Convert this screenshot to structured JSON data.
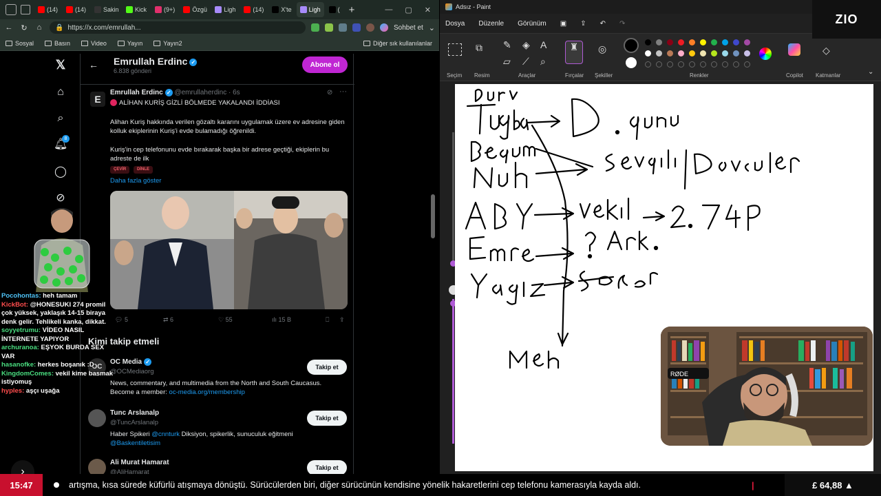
{
  "browser": {
    "tabs": [
      {
        "label": "(14)",
        "color": "#ff0000"
      },
      {
        "label": "(14)",
        "color": "#ff0000"
      },
      {
        "label": "Sakin",
        "color": "#333333"
      },
      {
        "label": "Kick",
        "color": "#53fc18"
      },
      {
        "label": "(9+)",
        "color": "#e1306c"
      },
      {
        "label": "Özgü",
        "color": "#ff0000"
      },
      {
        "label": "Ligh",
        "color": "#a78bfa"
      },
      {
        "label": "(14)",
        "color": "#ff0000"
      },
      {
        "label": "X'te",
        "color": "#000000"
      },
      {
        "label": "Ligh",
        "color": "#a78bfa"
      },
      {
        "label": "(",
        "color": "#000000"
      }
    ],
    "url": "https://x.com/emrullah...",
    "chat_button": "Sohbet et",
    "bookmarks": [
      "Sosyal",
      "Basın",
      "Video",
      "Yayın",
      "Yayın2"
    ],
    "other_bookmarks": "Diğer sık kullanılanlar"
  },
  "x": {
    "profile_name": "Emrullah Erdinc",
    "profile_posts": "6.838 gönderi",
    "subscribe": "Abone ol",
    "notif_count": "8",
    "post": {
      "author": "Emrullah Erdinc",
      "handle": "@emrullaherdinc · 6s",
      "headline": "ALİHAN KURİŞ GİZLİ BÖLMEDE YAKALANDI İDDİASI",
      "p1": "Alihan Kuriş hakkında verilen gözaltı kararını uygulamak üzere ev adresine giden kolluk ekiplerinin Kuriş'i evde bulamadığı öğrenildi.",
      "p2": "Kuriş'in cep telefonunu evde bırakarak başka bir adrese geçtiği, ekiplerin bu adreste de ilk",
      "pill1": "ÇEVİR",
      "pill2": "DİNLE",
      "show_more": "Daha fazla göster",
      "replies": "5",
      "reposts": "6",
      "likes": "55",
      "views": "15 B"
    },
    "who_to_follow": "Kimi takip etmeli",
    "follow_label": "Takip et",
    "accounts": [
      {
        "name": "OC Media",
        "handle": "@OCMediaorg",
        "bio": "News, commentary, and multimedia from the North and South Caucasus. Become a member: ",
        "link": "oc-media.org/membership"
      },
      {
        "name": "Tunc Arslanalp",
        "handle": "@TuncArslanalp",
        "bio_pre": "Haber Spikeri ",
        "bio_link1": "@cnnturk",
        "bio_mid": " Diksiyon, spikerlik, sunuculuk eğitmeni",
        "bio_link2": "@Baskentiletisim"
      },
      {
        "name": "Ali Murat Hamarat",
        "handle": "@AliHamarat"
      }
    ]
  },
  "chat": [
    {
      "user": "Pocohontas:",
      "msg": "heh tamam",
      "color": "#4fc3f7"
    },
    {
      "user": "KickBot:",
      "msg": "@HONESUKI 274 promil çok yüksek, yaklaşık 14-15 biraya denk gelir. Tehlikeli kanka, dikkat.",
      "color": "#ff4d4d"
    },
    {
      "user": "soyyetrumu:",
      "msg": "VİDEO NASIL İNTERNETE YAPIYOR",
      "color": "#4ade80"
    },
    {
      "user": "archuranoa:",
      "msg": "EŞYOK BURDA SEX VAR",
      "color": "#4ade80"
    },
    {
      "user": "hasanofke:",
      "msg": "herkes boşanık :D",
      "color": "#4ade80"
    },
    {
      "user": "KingdomComes:",
      "msg": "vekil kime basmak istiyomuş",
      "color": "#4ade80"
    },
    {
      "user": "hyples:",
      "msg": "aşçı uşağa",
      "color": "#ff4d4d"
    }
  ],
  "paint": {
    "title": "Adsız - Paint",
    "menu": [
      "Dosya",
      "Düzenle",
      "Görünüm"
    ],
    "sections": [
      "Seçim",
      "Resim",
      "Araçlar",
      "Fırçalar",
      "Şekiller",
      "Renkler",
      "Copilot",
      "Katmanlar"
    ],
    "palette": [
      "#000000",
      "#7f7f7f",
      "#880015",
      "#ed1c24",
      "#ff7f27",
      "#fff200",
      "#22b14c",
      "#00a2e8",
      "#3f48cc",
      "#a349a4",
      "#ffffff",
      "#c3c3c3",
      "#b97a57",
      "#ffaec9",
      "#ffc90e",
      "#efe4b0",
      "#b5e61d",
      "#99d9ea",
      "#7092be",
      "#c8bfe7"
    ]
  },
  "logo": "ZIO",
  "ticker": {
    "time": "15:47",
    "text": "artışma, kısa sürede küfürlü atışmaya dönüştü. Sürücülerden biri, diğer sürücünün kendisine yönelik hakaretlerini cep telefonu kamerasıyla kayda aldı.",
    "separator": "|",
    "currency": "£ 64,88 ▲"
  }
}
